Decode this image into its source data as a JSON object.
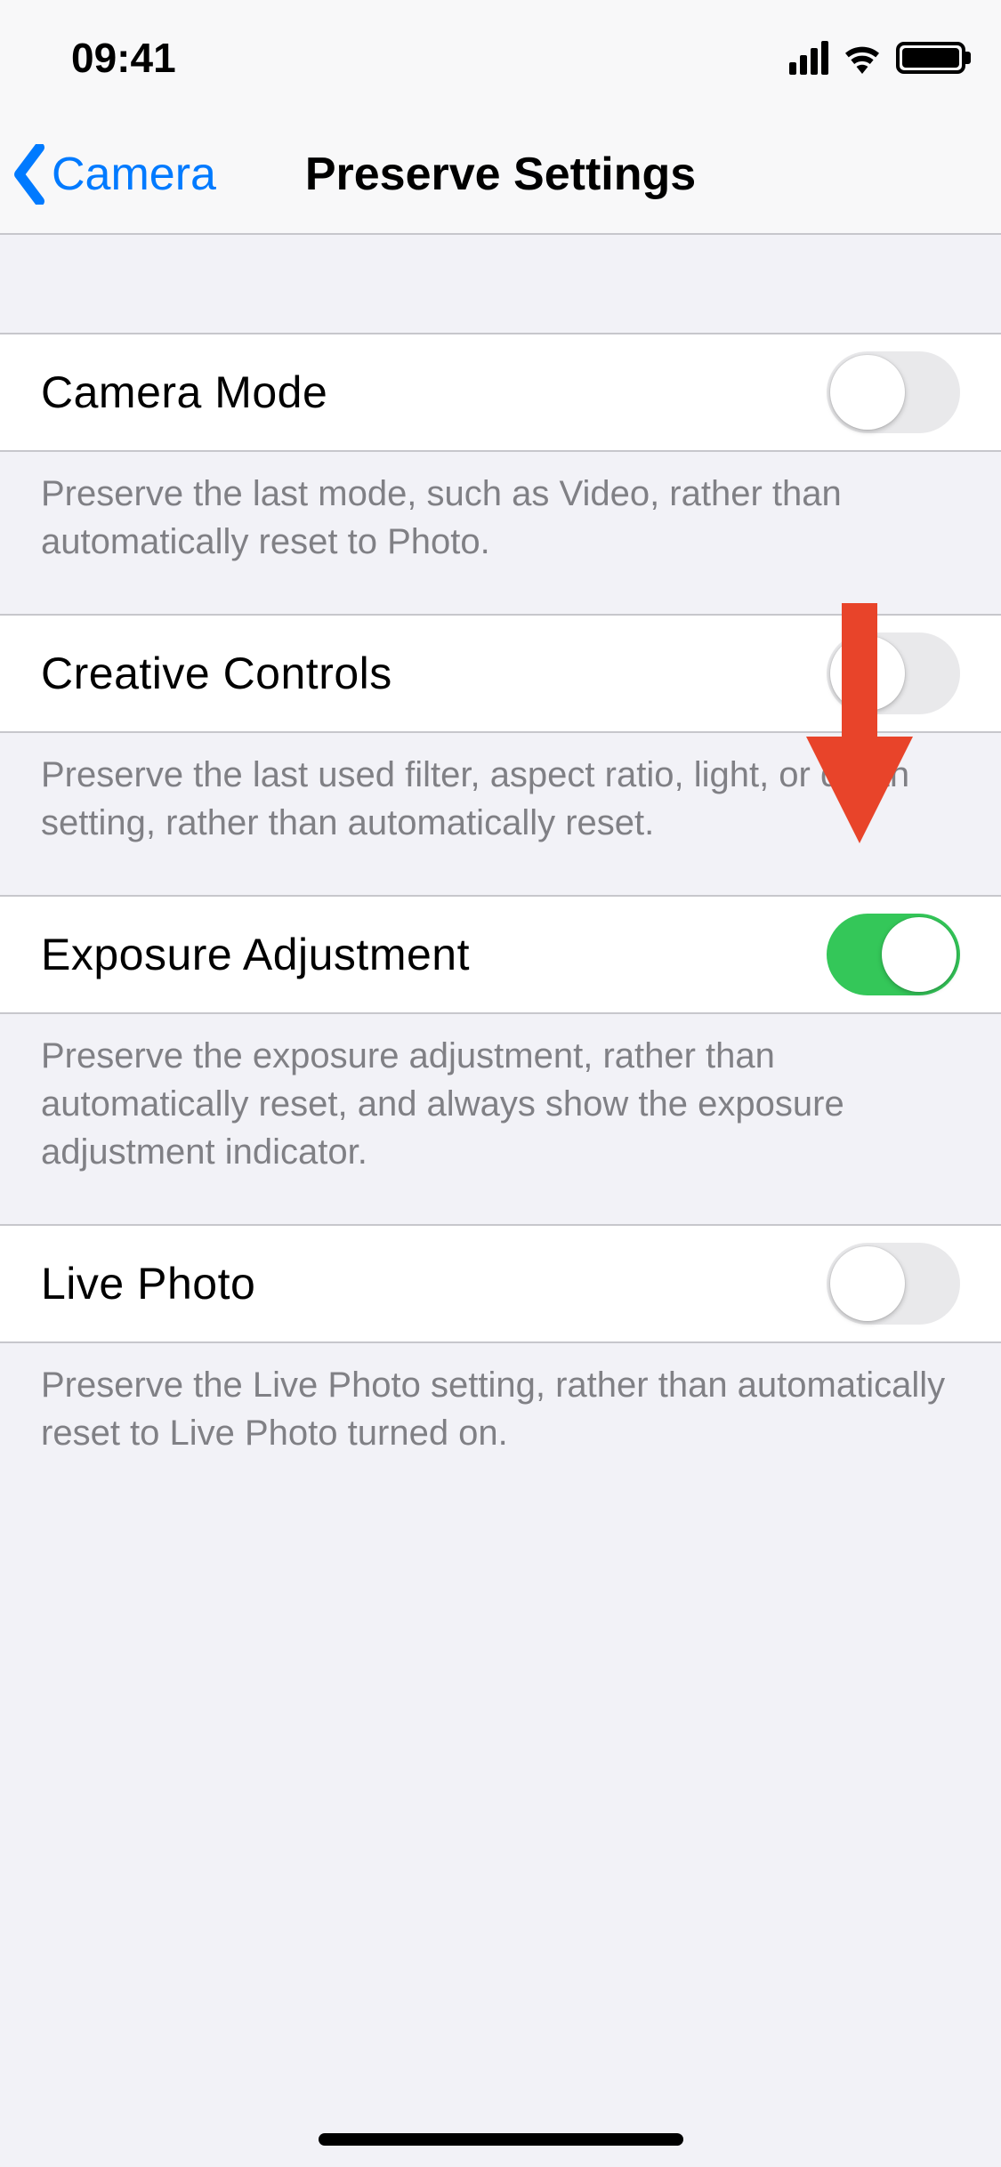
{
  "status": {
    "time": "09:41"
  },
  "nav": {
    "back_label": "Camera",
    "title": "Preserve Settings"
  },
  "rows": [
    {
      "label": "Camera Mode",
      "on": false,
      "footer": "Preserve the last mode, such as Video, rather than automatically reset to Photo."
    },
    {
      "label": "Creative Controls",
      "on": false,
      "footer": "Preserve the last used filter, aspect ratio, light, or depth setting, rather than automatically reset."
    },
    {
      "label": "Exposure Adjustment",
      "on": true,
      "footer": "Preserve the exposure adjustment, rather than automatically reset, and always show the exposure adjustment indicator."
    },
    {
      "label": "Live Photo",
      "on": false,
      "footer": "Preserve the Live Photo setting, rather than automatically reset to Live Photo turned on."
    }
  ],
  "annotation": {
    "arrow_color": "#e8442a"
  }
}
